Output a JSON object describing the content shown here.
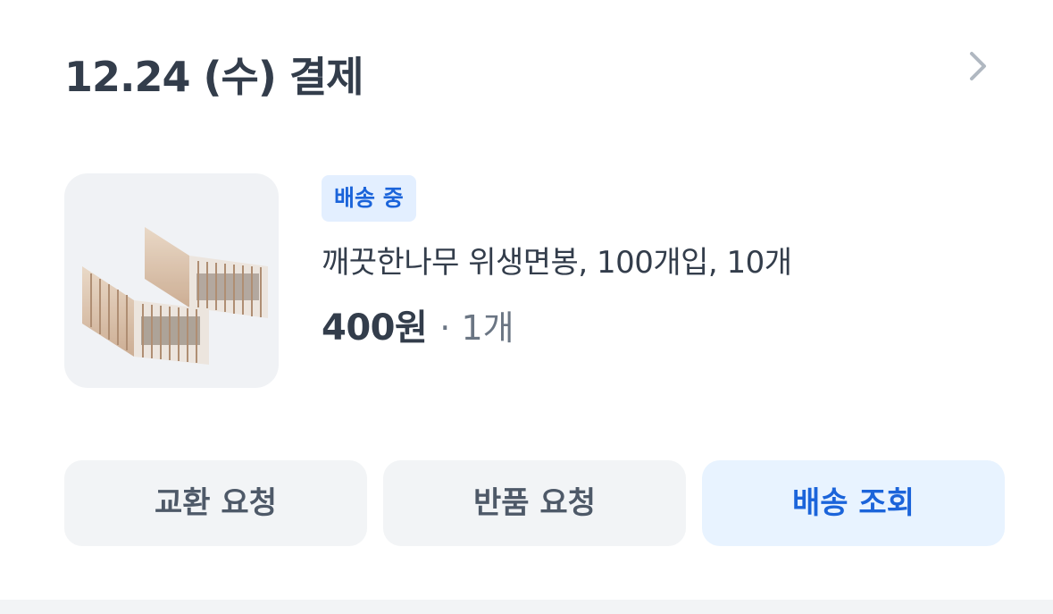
{
  "order": {
    "title": "12.24 (수) 결제",
    "status": "배송 중",
    "product_name": "깨끗한나무 위생면봉, 100개입, 10개",
    "price": "400원",
    "quantity": "· 1개"
  },
  "actions": {
    "exchange": "교환 요청",
    "return": "반품 요청",
    "track": "배송 조회"
  },
  "icons": {
    "detail": "chevron-right-icon",
    "product_image": "cotton-swab-product-image"
  },
  "colors": {
    "title_text": "#333d4b",
    "badge_bg": "#e3efff",
    "accent_blue": "#1b64da",
    "secondary_bg": "#f2f4f6",
    "primary_btn_bg": "#e8f3ff"
  }
}
